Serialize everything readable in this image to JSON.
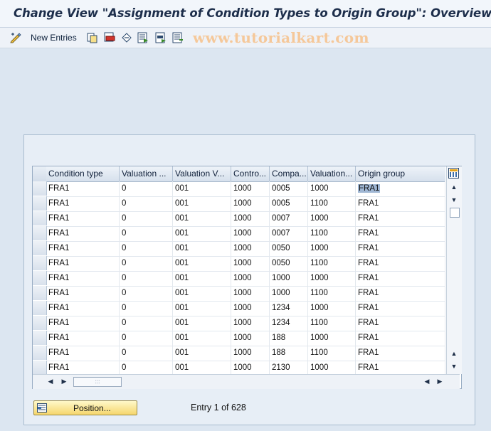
{
  "title": "Change View \"Assignment of Condition Types to Origin Group\": Overview",
  "toolbar": {
    "new_entries_label": "New Entries"
  },
  "watermark": "www.tutorialkart.com",
  "table": {
    "columns": [
      "Condition type",
      "Valuation ...",
      "Valuation V...",
      "Contro...",
      "Compa...",
      "Valuation...",
      "Origin group"
    ],
    "rows": [
      [
        "FRA1",
        "0",
        "001",
        "1000",
        "0005",
        "1000",
        "FRA1"
      ],
      [
        "FRA1",
        "0",
        "001",
        "1000",
        "0005",
        "1100",
        "FRA1"
      ],
      [
        "FRA1",
        "0",
        "001",
        "1000",
        "0007",
        "1000",
        "FRA1"
      ],
      [
        "FRA1",
        "0",
        "001",
        "1000",
        "0007",
        "1100",
        "FRA1"
      ],
      [
        "FRA1",
        "0",
        "001",
        "1000",
        "0050",
        "1000",
        "FRA1"
      ],
      [
        "FRA1",
        "0",
        "001",
        "1000",
        "0050",
        "1100",
        "FRA1"
      ],
      [
        "FRA1",
        "0",
        "001",
        "1000",
        "1000",
        "1000",
        "FRA1"
      ],
      [
        "FRA1",
        "0",
        "001",
        "1000",
        "1000",
        "1100",
        "FRA1"
      ],
      [
        "FRA1",
        "0",
        "001",
        "1000",
        "1234",
        "1000",
        "FRA1"
      ],
      [
        "FRA1",
        "0",
        "001",
        "1000",
        "1234",
        "1100",
        "FRA1"
      ],
      [
        "FRA1",
        "0",
        "001",
        "1000",
        "188",
        "1000",
        "FRA1"
      ],
      [
        "FRA1",
        "0",
        "001",
        "1000",
        "188",
        "1100",
        "FRA1"
      ],
      [
        "FRA1",
        "0",
        "001",
        "1000",
        "2130",
        "1000",
        "FRA1"
      ]
    ]
  },
  "position_button_label": "Position...",
  "entry_status": "Entry 1 of 628",
  "colors": {
    "accent_button": "#f5d66c",
    "title_text": "#1d2e4b",
    "watermark": "#f5c89a",
    "selected_cell": "#9fb6d3"
  }
}
